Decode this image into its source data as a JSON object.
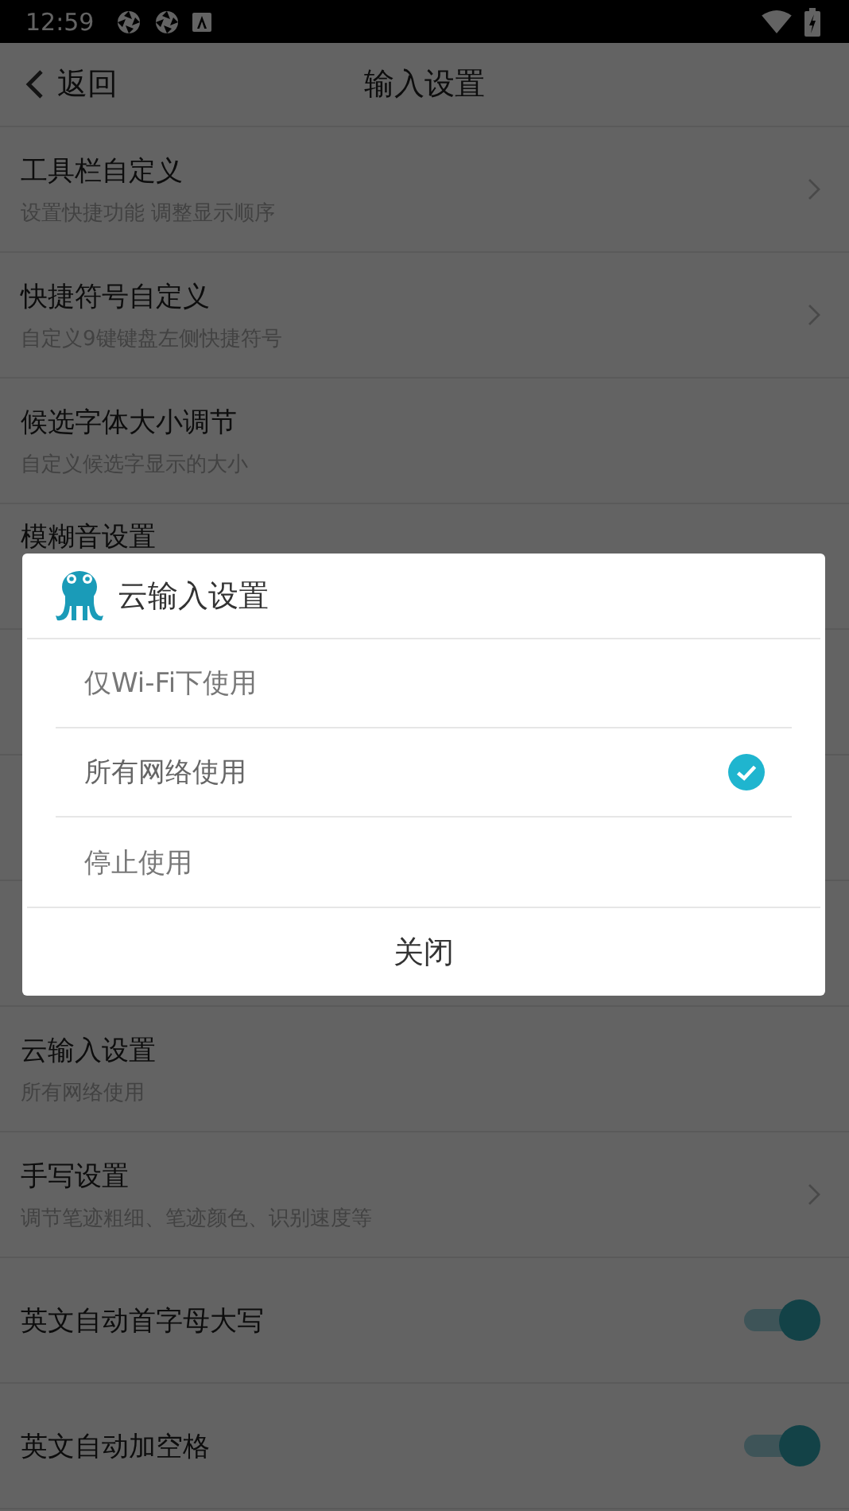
{
  "status_bar": {
    "time": "12:59"
  },
  "header": {
    "back_label": "返回",
    "title": "输入设置"
  },
  "settings": [
    {
      "kind": "link",
      "title": "工具栏自定义",
      "subtitle": "设置快捷功能 调整显示顺序"
    },
    {
      "kind": "link",
      "title": "快捷符号自定义",
      "subtitle": "自定义9键键盘左侧快捷符号"
    },
    {
      "kind": "plain",
      "title": "候选字体大小调节",
      "subtitle": "自定义候选字显示的大小"
    },
    {
      "kind": "covered",
      "title": "模糊音设置"
    },
    {
      "kind": "plain",
      "title": "云输入设置",
      "subtitle": "所有网络使用"
    },
    {
      "kind": "link",
      "title": "手写设置",
      "subtitle": "调节笔迹粗细、笔迹颜色、识别速度等"
    },
    {
      "kind": "toggle",
      "title": "英文自动首字母大写",
      "on": true
    },
    {
      "kind": "toggle",
      "title": "英文自动加空格",
      "on": true
    }
  ],
  "dialog": {
    "title": "云输入设置",
    "options": [
      {
        "label": "仅Wi-Fi下使用",
        "selected": false
      },
      {
        "label": "所有网络使用",
        "selected": true
      },
      {
        "label": "停止使用",
        "selected": false
      }
    ],
    "close_label": "关闭"
  }
}
